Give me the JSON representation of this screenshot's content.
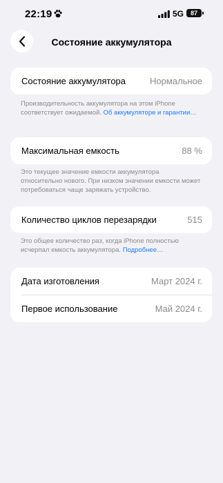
{
  "status_bar": {
    "time": "22:19",
    "network": "5G",
    "battery_level": "87"
  },
  "header": {
    "title": "Состояние аккумулятора"
  },
  "battery_health": {
    "label": "Состояние аккумулятора",
    "value": "Нормальное",
    "footnote": "Производительность аккумулятора на этом iPhone соответствует ожидаемой.",
    "link": "Об аккумуляторе и гарантии…"
  },
  "max_capacity": {
    "label": "Максимальная емкость",
    "value": "88 %",
    "footnote": "Это текущее значение емкости аккумулятора относительно нового. При низком значении емкости может потребоваться чаще заряжать устройство."
  },
  "cycle_count": {
    "label": "Количество циклов перезарядки",
    "value": "515",
    "footnote": "Это общее количество раз, когда iPhone полностью исчерпал емкость аккумулятора.",
    "link": "Подробнее…"
  },
  "dates": {
    "manufacture_label": "Дата изготовления",
    "manufacture_value": "Март 2024 г.",
    "first_use_label": "Первое использование",
    "first_use_value": "Май 2024 г."
  }
}
